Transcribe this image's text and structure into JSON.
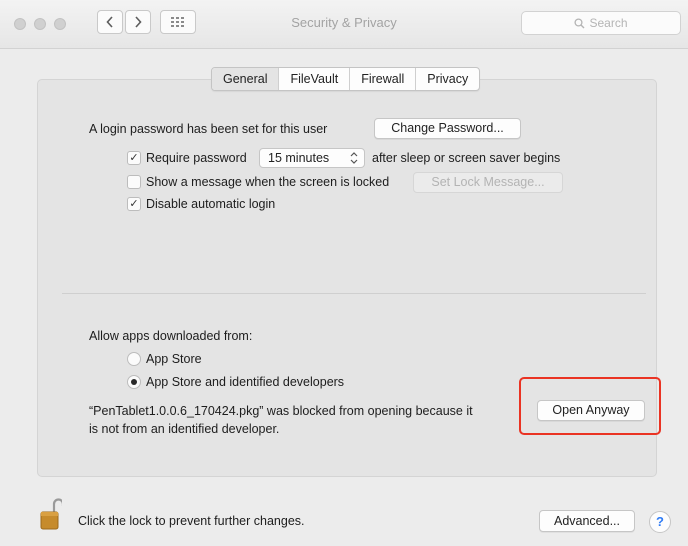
{
  "window": {
    "title": "Security & Privacy",
    "search_placeholder": "Search",
    "nav": {
      "back_icon": "chevron-left-icon",
      "forward_icon": "chevron-right-icon",
      "grid_icon": "grid-icon"
    }
  },
  "tabs": [
    {
      "label": "General",
      "active": true
    },
    {
      "label": "FileVault",
      "active": false
    },
    {
      "label": "Firewall",
      "active": false
    },
    {
      "label": "Privacy",
      "active": false
    }
  ],
  "general": {
    "login_password_text": "A login password has been set for this user",
    "change_password_label": "Change Password...",
    "require_password": {
      "checked": true,
      "label": "Require password",
      "interval": "15 minutes",
      "suffix": "after sleep or screen saver begins"
    },
    "show_message": {
      "checked": false,
      "label": "Show a message when the screen is locked",
      "button_label": "Set Lock Message..."
    },
    "disable_auto_login": {
      "checked": true,
      "label": "Disable automatic login"
    }
  },
  "downloads": {
    "heading": "Allow apps downloaded from:",
    "options": [
      {
        "label": "App Store",
        "selected": false
      },
      {
        "label": "App Store and identified developers",
        "selected": true
      }
    ],
    "blocked_line1": "“PenTablet1.0.0.6_170424.pkg” was blocked from opening because it",
    "blocked_line2": "is not from an identified developer.",
    "open_anyway_label": "Open Anyway",
    "highlight_color": "#ea3323"
  },
  "footer": {
    "lock_text": "Click the lock to prevent further changes.",
    "advanced_label": "Advanced...",
    "help_label": "?",
    "lock_icon": "unlocked-padlock-icon"
  },
  "colors": {
    "window_bg": "#ececec",
    "panel_bg": "#e4e4e4",
    "help_accent": "#2f7cf6"
  }
}
